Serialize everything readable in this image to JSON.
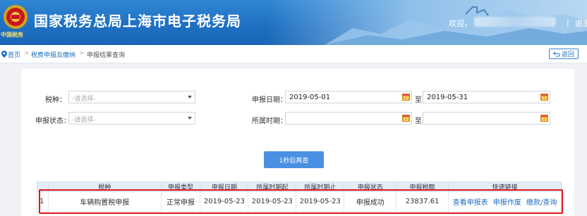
{
  "header": {
    "title": "国家税务总局上海市电子税务局",
    "emblem_caption": "中国税务",
    "welcome": "欢迎，",
    "separator": "|",
    "logout": "退出"
  },
  "breadcrumb": {
    "home": "首页",
    "sep": ">",
    "level1": "税费申报及缴纳",
    "level2": "申报结果查询"
  },
  "back_button": "返回",
  "form": {
    "tax_type": {
      "label": "税种：",
      "placeholder": "-请选择-"
    },
    "report_date": {
      "label": "申报日期：",
      "from": "2019-05-01",
      "to_label": "至",
      "to": "2019-05-31"
    },
    "report_status": {
      "label": "申报状态：",
      "placeholder": "-请选择-"
    },
    "period": {
      "label": "所属时期：",
      "from": "",
      "to_label": "至",
      "to": ""
    }
  },
  "query_button": "1秒后再查",
  "table": {
    "headers": [
      "",
      "税种",
      "申报类型",
      "申报日期",
      "所属时期起",
      "所属时期止",
      "申报状态",
      "申报税额",
      "快速链接"
    ],
    "rows": [
      {
        "index": "1",
        "tax_type": "车辆购置税申报",
        "report_type": "正常申报",
        "report_date": "2019-05-23",
        "period_start": "2019-05-23",
        "period_end": "2019-05-23",
        "status": "申报成功",
        "amount": "23837.61",
        "links": [
          "查看申报表",
          "申报作废",
          "缴款/查询"
        ]
      }
    ]
  },
  "colors": {
    "header_blue": "#1f6fc1",
    "link_blue": "#1f6fc1",
    "highlight_red": "#e3141b",
    "button_blue": "#4a90e2"
  }
}
